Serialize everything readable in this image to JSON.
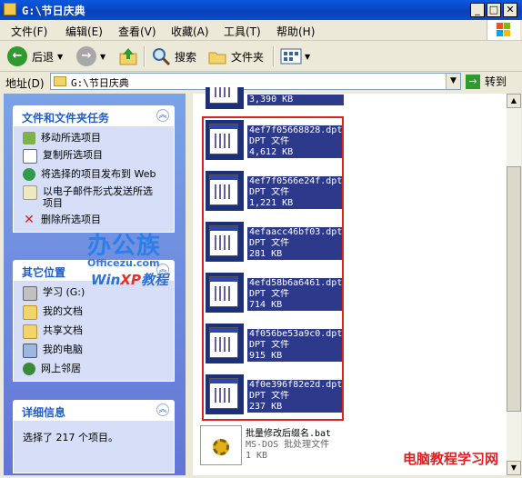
{
  "window": {
    "title": "G:\\节日庆典"
  },
  "menu": [
    "文件(F)",
    "编辑(E)",
    "查看(V)",
    "收藏(A)",
    "工具(T)",
    "帮助(H)"
  ],
  "toolbar": {
    "back": "后退",
    "search": "搜索",
    "folders": "文件夹"
  },
  "address": {
    "label": "地址(D)",
    "value": "G:\\节日庆典",
    "go": "转到"
  },
  "tasks": {
    "title": "文件和文件夹任务",
    "items": [
      "移动所选项目",
      "复制所选项目",
      "将选择的项目发布到 Web",
      "以电子邮件形式发送所选项目",
      "删除所选项目"
    ]
  },
  "places": {
    "title": "其它位置",
    "items": [
      "学习 (G:)",
      "我的文档",
      "共享文档",
      "我的电脑",
      "网上邻居"
    ]
  },
  "details": {
    "title": "详细信息",
    "text": "选择了 217 个项目。"
  },
  "files": [
    {
      "name": "",
      "type": "",
      "size": "3,390 KB"
    },
    {
      "name": "4ef7f05668828.dpt",
      "type": "DPT 文件",
      "size": "4,612 KB"
    },
    {
      "name": "4ef7f0566e24f.dpt",
      "type": "DPT 文件",
      "size": "1,221 KB"
    },
    {
      "name": "4efaacc46bf03.dpt",
      "type": "DPT 文件",
      "size": "281 KB"
    },
    {
      "name": "4efd58b6a6461.dpt",
      "type": "DPT 文件",
      "size": "714 KB"
    },
    {
      "name": "4f056be53a9c0.dpt",
      "type": "DPT 文件",
      "size": "915 KB"
    },
    {
      "name": "4f0e396f82e2d.dpt",
      "type": "DPT 文件",
      "size": "237 KB"
    }
  ],
  "bat": {
    "name": "批量修改后缀名.bat",
    "type": "MS-DOS 批处理文件",
    "size": "1 KB"
  },
  "watermark": {
    "brand": "办公族",
    "site": "Officezu.com",
    "win": "Win",
    "xp": "XP",
    "course": "教程",
    "corner": "电脑教程学习网"
  },
  "colors": {
    "title_bar": "#0842b8",
    "selection": "#2d3a8c",
    "highlight_box": "#e02020",
    "task_pane": "#7ba2e7"
  }
}
